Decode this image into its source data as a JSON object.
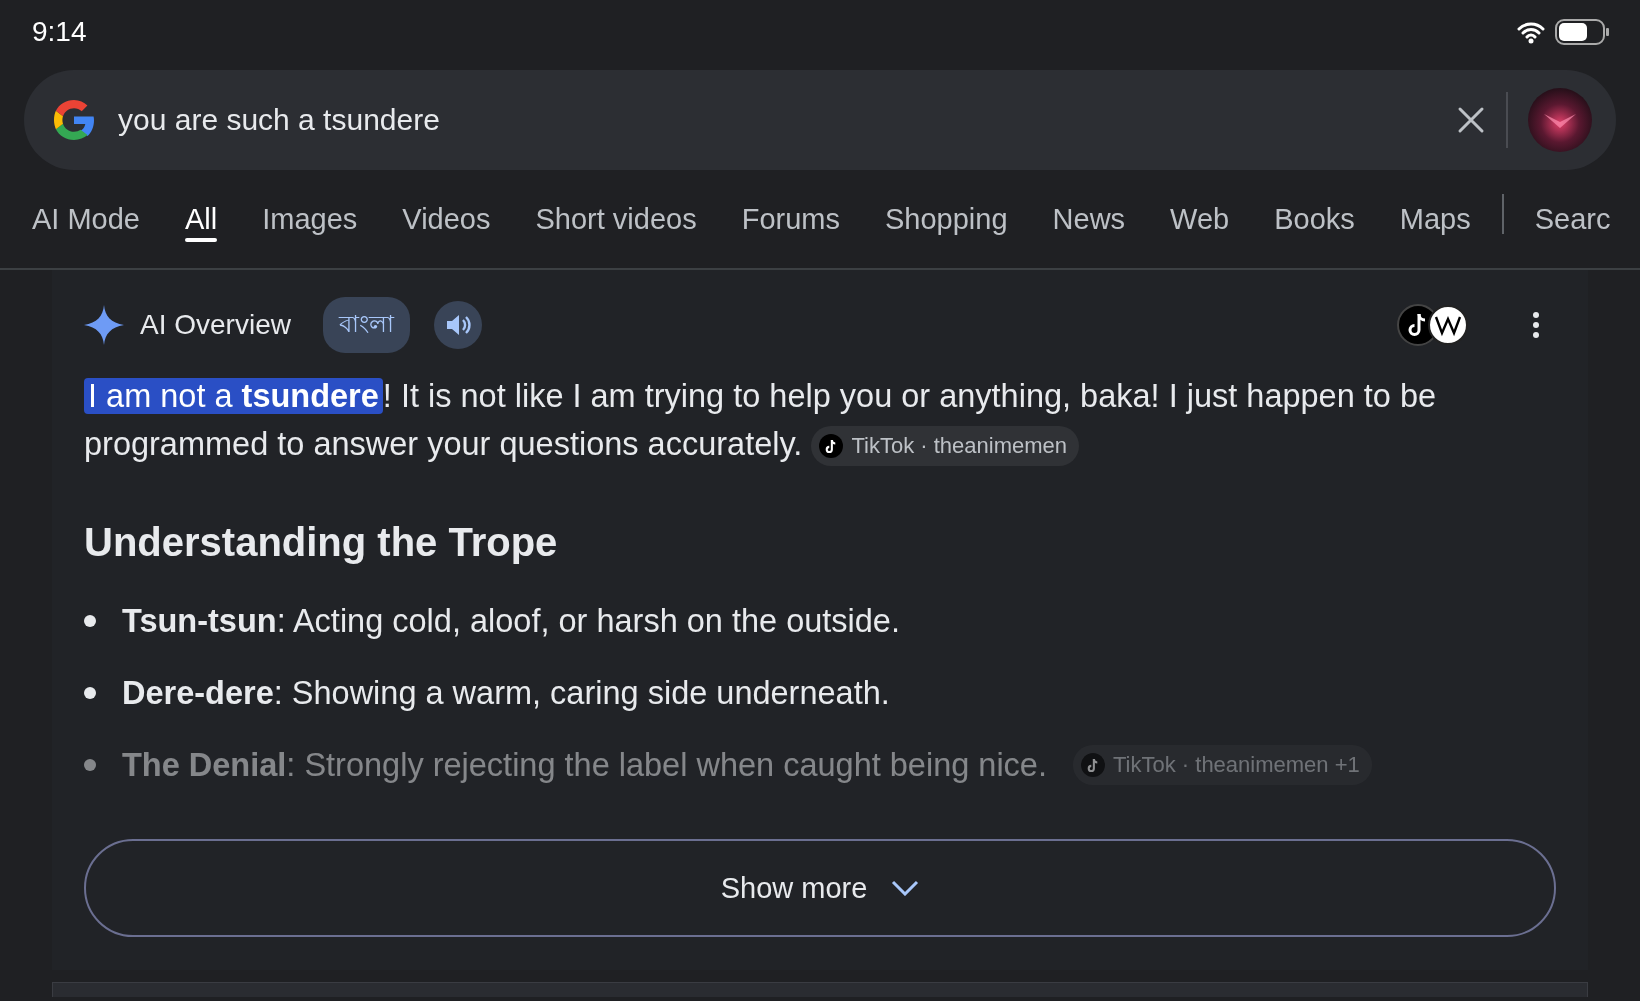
{
  "status_bar": {
    "time": "9:14"
  },
  "search": {
    "value": "you are such a tsundere"
  },
  "tabs": [
    {
      "label": "AI Mode",
      "selected": false
    },
    {
      "label": "All",
      "selected": true
    },
    {
      "label": "Images",
      "selected": false
    },
    {
      "label": "Videos",
      "selected": false
    },
    {
      "label": "Short videos",
      "selected": false
    },
    {
      "label": "Forums",
      "selected": false
    },
    {
      "label": "Shopping",
      "selected": false
    },
    {
      "label": "News",
      "selected": false
    },
    {
      "label": "Web",
      "selected": false
    },
    {
      "label": "Books",
      "selected": false
    },
    {
      "label": "Maps",
      "selected": false
    },
    {
      "label": "Searc",
      "selected": false
    }
  ],
  "overview": {
    "title": "AI Overview",
    "language": "বাংলা",
    "answer": {
      "highlight": "I am not a **tsundere**",
      "text": "! It is not like I am trying to help you or anything, baka! I just happen to be programmed to answer your questions accurately.",
      "source": "TikTok · theanimemen"
    },
    "heading": "Understanding the Trope",
    "bullets": [
      {
        "text": "**Tsun-tsun**: Acting cold, aloof, or harsh on the outside.",
        "faded": false
      },
      {
        "text": "**Dere-dere**: Showing a warm, caring side underneath.",
        "faded": false
      },
      {
        "text": "**The Denial**: Strongly rejecting the label when caught being nice.",
        "source": "TikTok · theanimemen +1",
        "faded": true
      }
    ],
    "show_more": "Show more"
  }
}
